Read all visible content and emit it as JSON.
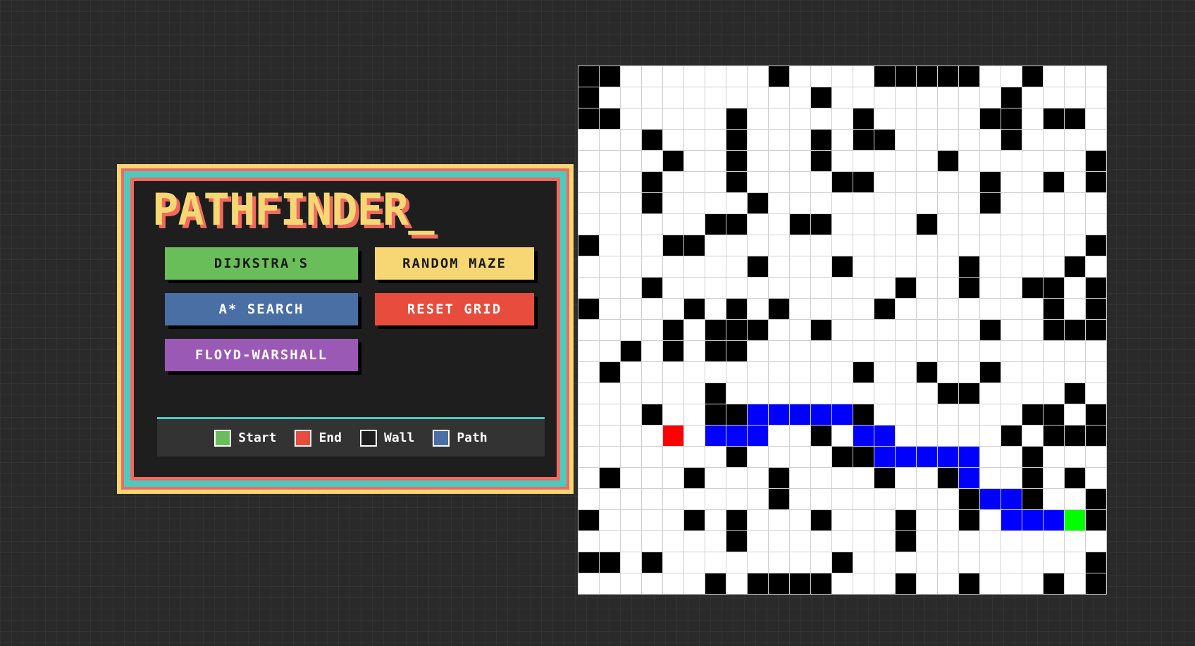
{
  "app": {
    "title": "PATHFINDER_"
  },
  "buttons": {
    "dijkstra": "DIJKSTRA'S",
    "random_maze": "RANDOM MAZE",
    "astar": "A* SEARCH",
    "reset_grid": "RESET GRID",
    "floyd_warshall": "FLOYD-WARSHALL"
  },
  "legend": {
    "items": [
      {
        "label": "Start",
        "color": "#6abe5a"
      },
      {
        "label": "End",
        "color": "#e74c3c"
      },
      {
        "label": "Wall",
        "color": "#1e1e1e"
      },
      {
        "label": "Path",
        "color": "#4a6fa5"
      }
    ]
  },
  "colors": {
    "background": "#2a2a2a",
    "panel_border_yellow": "#f7d774",
    "panel_border_teal": "#4ec9c0",
    "panel_border_coral": "#f06a5f",
    "wall": "#000000",
    "path": "#0000ff",
    "start": "#00ff00",
    "end": "#ff0000",
    "empty": "#ffffff"
  },
  "grid": {
    "rows": 25,
    "cols": 25,
    "legend_key": "W = wall, P = path, S = start, E = end, . = empty",
    "cells": [
      "WW.......W....WWWWW..W....",
      "W..........W........W....",
      "WW.....W.....W.....WW.WW.",
      "...W...W...W.WW.....W....",
      "....W..W...W.....W......W",
      "...W...W....WW.....W..W.W",
      "...W....W..........W.....",
      "......WW..WW....W........",
      "W...WW..................W",
      "........W...W.....W....W.",
      "...W...........W..W..WW.W",
      "W....W.W.W....W.......W.W",
      "....W.WWW..W.......W..WWW",
      "..W.W.WW.................",
      ".W...........W..W..W.....",
      "......W..........WW....W.",
      "...W..WWPPPPPW.......WW.W",
      "....E.PPP..W.PP.....W.WWW",
      ".......W....WWPPPPP..W...",
      ".W...W...W....W..WP..W.W.",
      ".........W........WPPW..W",
      "W....W.W...W...W..W.PPPSW.",
      ".......W.......W.........W",
      "WW.W........W...........W",
      "......W.WWWW...W..W...W.W"
    ]
  }
}
